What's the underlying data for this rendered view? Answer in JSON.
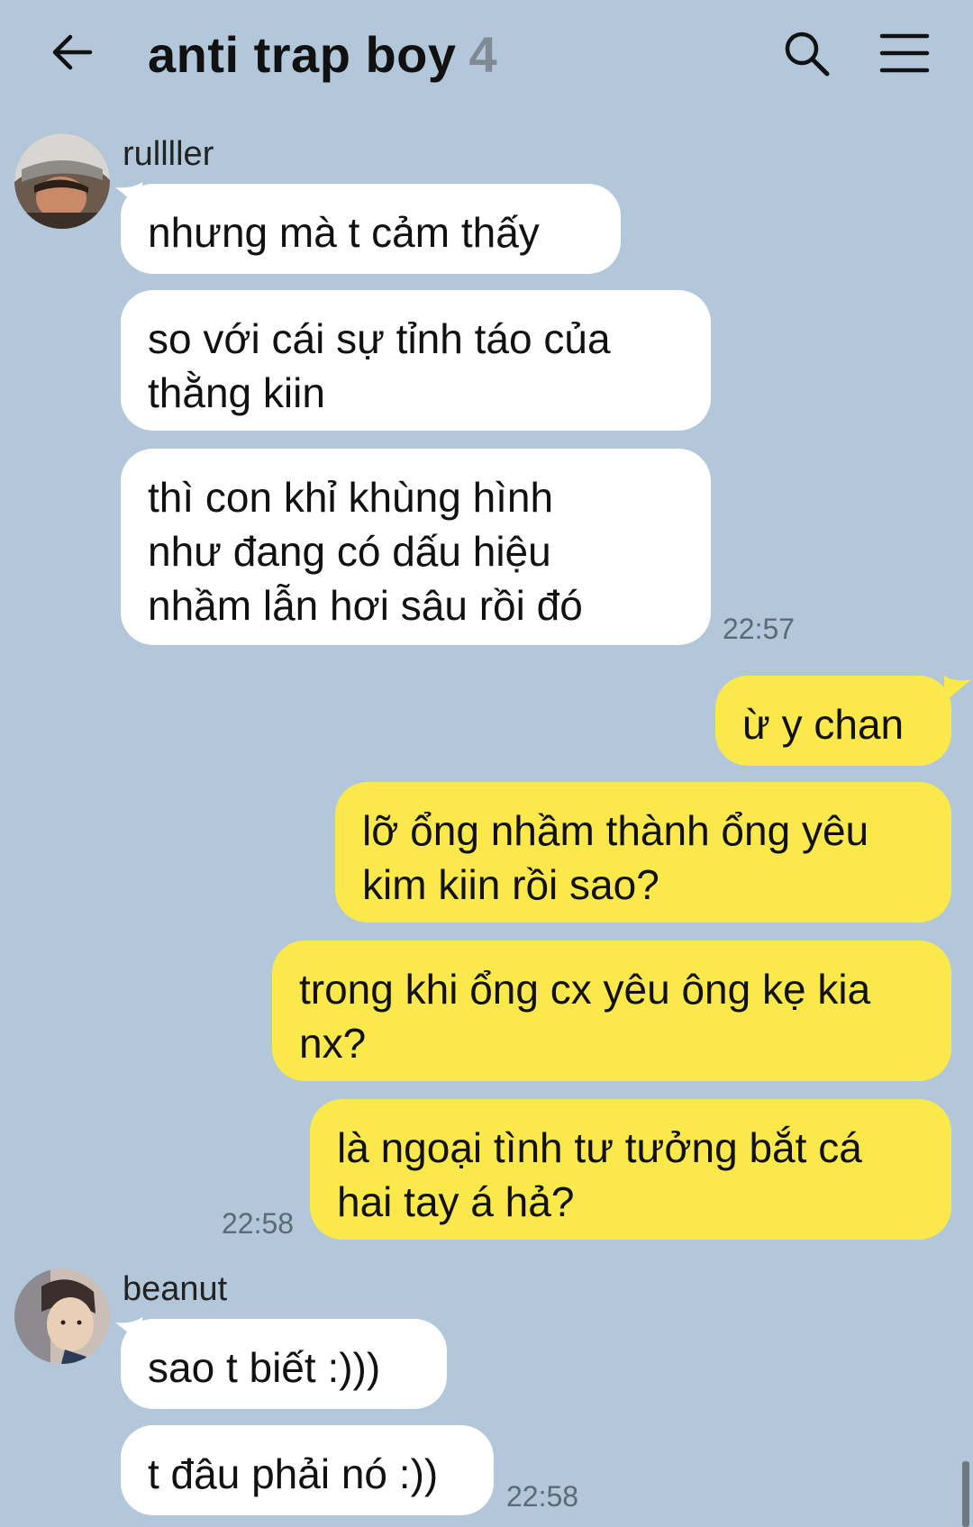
{
  "header": {
    "title": "anti trap boy",
    "member_count": "4",
    "back_icon": "arrow-left-icon",
    "search_icon": "search-icon",
    "menu_icon": "hamburger-menu-icon"
  },
  "colors": {
    "background": "#b2c7da",
    "incoming_bubble": "#ffffff",
    "outgoing_bubble": "#fbe84a",
    "timestamp": "#5b6a78"
  },
  "messages": {
    "group1": {
      "sender": "rullller",
      "bubble1": [
        "nhưng mà t cảm thấy"
      ],
      "bubble2": [
        "so với cái sự tỉnh táo của",
        "thằng kiin"
      ],
      "bubble3": [
        "thì con khỉ khùng hình",
        "như đang có dấu hiệu",
        "nhầm lẫn hơi sâu rồi đó"
      ],
      "time": "22:57"
    },
    "group2": {
      "bubble1": [
        "ừ y chan"
      ],
      "bubble2": [
        "lỡ ổng nhầm thành ổng yêu",
        "kim kiin rồi sao?"
      ],
      "bubble3": [
        "trong khi ổng cx yêu ông kẹ kia",
        "nx?"
      ],
      "bubble4": [
        "là ngoại tình tư tưởng bắt cá",
        "hai tay á hả?"
      ],
      "time": "22:58"
    },
    "group3": {
      "sender": "beanut",
      "bubble1": [
        "sao t biết :)))"
      ],
      "bubble2": [
        "t đâu phải nó :))"
      ],
      "time": "22:58"
    }
  }
}
